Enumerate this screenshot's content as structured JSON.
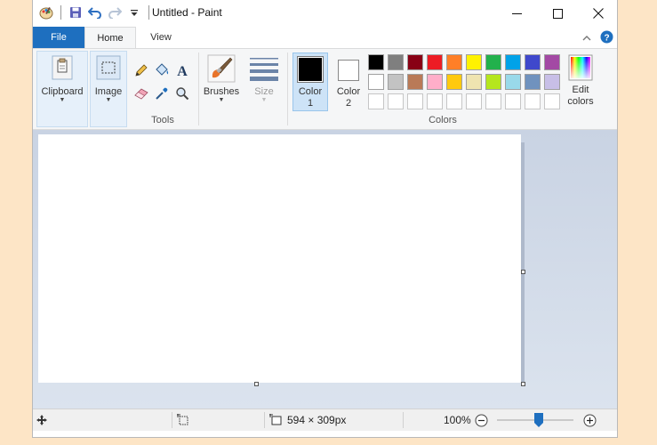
{
  "window": {
    "title": "Untitled - Paint"
  },
  "tabs": {
    "file": "File",
    "home": "Home",
    "view": "View"
  },
  "ribbon": {
    "clipboard": "Clipboard",
    "image": "Image",
    "tools_group": "Tools",
    "brushes": "Brushes",
    "size": "Size",
    "color1_line1": "Color",
    "color1_line2": "1",
    "color2_line1": "Color",
    "color2_line2": "2",
    "edit_colors_line1": "Edit",
    "edit_colors_line2": "colors",
    "colors_group": "Colors",
    "color1_value": "#000000",
    "color2_value": "#ffffff"
  },
  "palette": {
    "row1": [
      "#000000",
      "#7f7f7f",
      "#880015",
      "#ed1c24",
      "#ff7f27",
      "#fff200",
      "#22b14c",
      "#00a2e8",
      "#3f48cc",
      "#a349a4"
    ],
    "row2": [
      "#ffffff",
      "#c3c3c3",
      "#b97a57",
      "#ffaec9",
      "#ffc90e",
      "#efe4b0",
      "#b5e61d",
      "#99d9ea",
      "#7092be",
      "#c8bfe7"
    ],
    "row3_empty_count": 10
  },
  "status": {
    "canvas_size": "594 × 309px",
    "zoom": "100%",
    "zoom_level": 0.5
  }
}
